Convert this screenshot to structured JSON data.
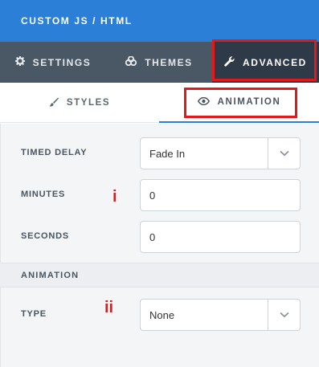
{
  "header": {
    "title": "CUSTOM JS / HTML"
  },
  "main_tabs": [
    {
      "label": "SETTINGS",
      "icon": "gear-icon"
    },
    {
      "label": "THEMES",
      "icon": "palette-icon"
    },
    {
      "label": "ADVANCED",
      "icon": "wrench-icon",
      "active": true
    }
  ],
  "sub_tabs": [
    {
      "label": "STYLES",
      "icon": "brush-icon"
    },
    {
      "label": "ANIMATION",
      "icon": "eye-icon",
      "active": true
    }
  ],
  "form": {
    "timed_delay": {
      "label": "TIMED DELAY",
      "value": "Fade In"
    },
    "minutes": {
      "label": "MINUTES",
      "value": "0"
    },
    "seconds": {
      "label": "SECONDS",
      "value": "0"
    }
  },
  "animation_section": {
    "title": "ANIMATION",
    "type": {
      "label": "TYPE",
      "value": "None"
    }
  },
  "annotations": {
    "first": "i",
    "second": "ii"
  },
  "colors": {
    "header": "#2b7fd6",
    "tabs_bg": "#4a5765",
    "active_tab": "#2e3a47",
    "highlight": "#e01a1a"
  }
}
